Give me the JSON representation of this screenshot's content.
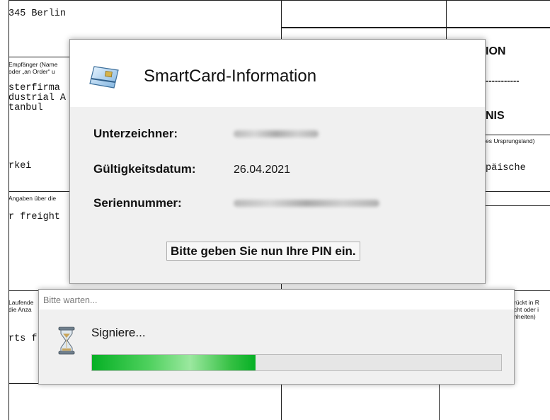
{
  "document": {
    "address_line": "345 Berlin",
    "consignee_label_1": "Empfänger (Name",
    "consignee_label_2": "oder „an Order“ u",
    "consignee_1": "sterfirma",
    "consignee_2": "dustrial A",
    "consignee_3": "tanbul",
    "country": "rkei",
    "transport_label": "Angaben über die",
    "transport": "r freight",
    "item_label_1": "Laufende",
    "item_label_2": "die Anza",
    "item_text": "rts f",
    "heading_1": "ION",
    "dashes": "-----------",
    "heading_2": "NIS",
    "origin_label": "es Ursprungsland)",
    "origin_value": "päische",
    "right_note_1": "rückt in R",
    "right_note_2": "cht oder i",
    "right_note_3": "nheiten)"
  },
  "smartcard": {
    "title": "SmartCard-Information",
    "signer_label": "Unterzeichner:",
    "validity_label": "Gültigkeitsdatum:",
    "validity_value": "26.04.2021",
    "serial_label": "Seriennummer:",
    "pin_prompt": "Bitte geben Sie nun Ihre PIN ein."
  },
  "wait_dialog": {
    "title": "Bitte warten...",
    "status": "Signiere...",
    "progress_percent": 40
  },
  "colors": {
    "progress_green": "#06b025",
    "dialog_bg": "#f0f0f0"
  },
  "icons": {
    "smartcard": "smartcard-icon",
    "wait": "hourglass-icon"
  }
}
